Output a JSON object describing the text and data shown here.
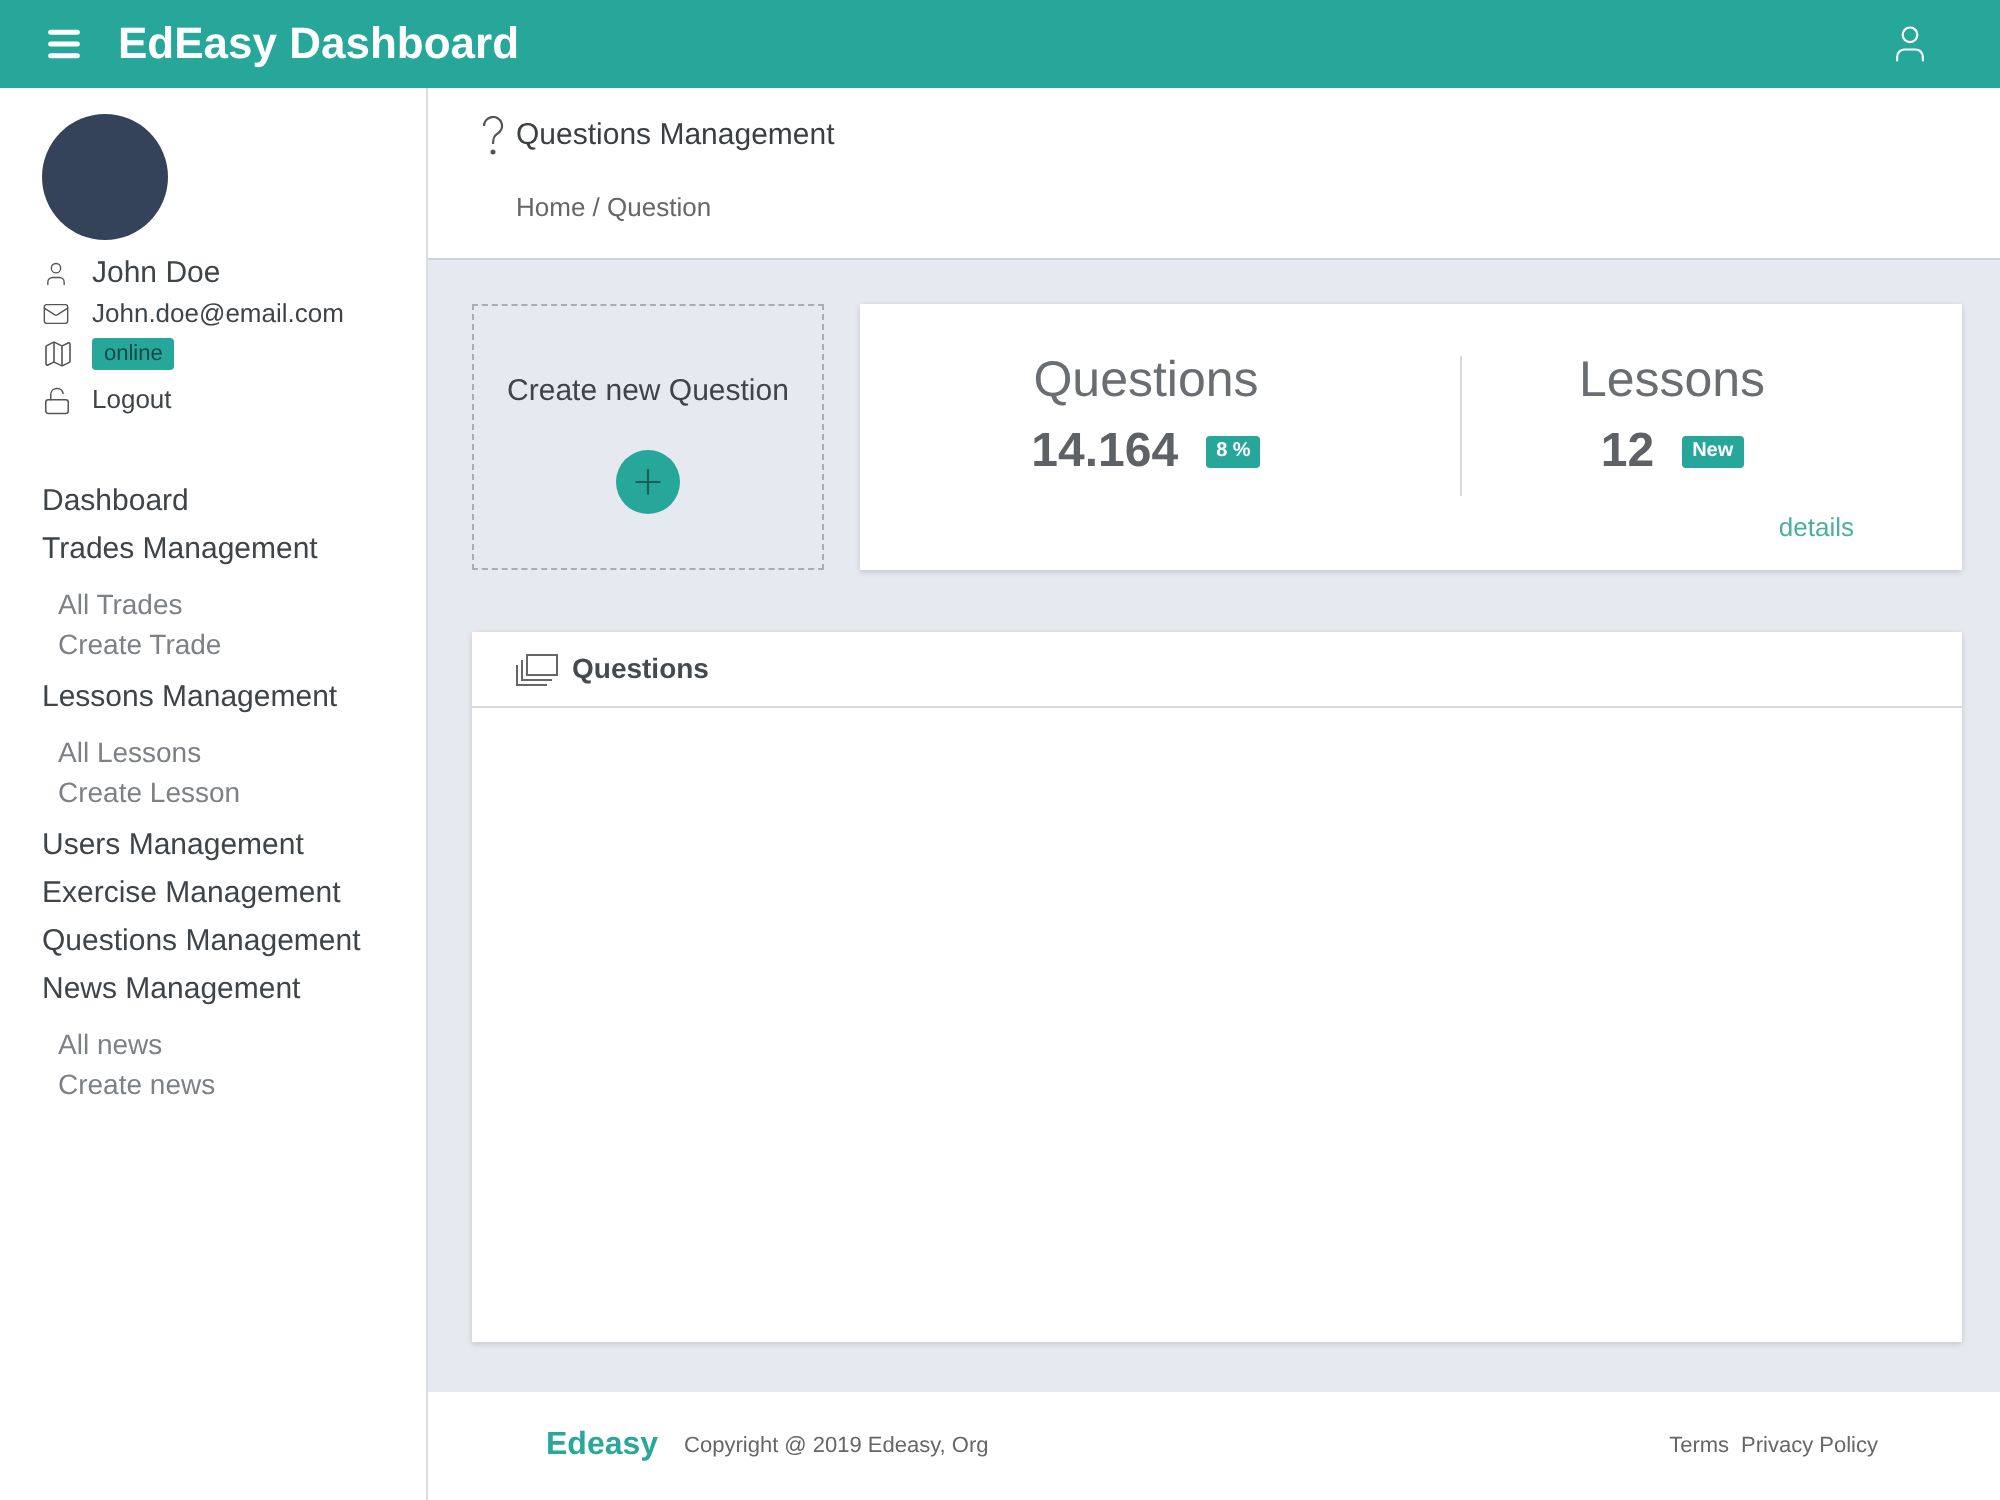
{
  "header": {
    "title": "EdEasy Dashboard"
  },
  "profile": {
    "name": "John Doe",
    "email": "John.doe@email.com",
    "status": "online",
    "logout": "Logout"
  },
  "sidebar": {
    "items": [
      {
        "label": "Dashboard"
      },
      {
        "label": "Trades Management",
        "children": [
          {
            "label": "All Trades"
          },
          {
            "label": "Create Trade"
          }
        ]
      },
      {
        "label": "Lessons Management",
        "children": [
          {
            "label": "All Lessons"
          },
          {
            "label": "Create Lesson"
          }
        ]
      },
      {
        "label": "Users Management"
      },
      {
        "label": "Exercise Management"
      },
      {
        "label": "Questions Management"
      },
      {
        "label": "News Management",
        "children": [
          {
            "label": "All news"
          },
          {
            "label": "Create news"
          }
        ]
      }
    ]
  },
  "page_header": {
    "title": "Questions Management",
    "breadcrumb": "Home / Question"
  },
  "create_card": {
    "label": "Create new Question"
  },
  "stats": {
    "items": [
      {
        "label": "Questions",
        "value": "14.164",
        "badge": "8 %"
      },
      {
        "label": "Lessons",
        "value": "12",
        "badge": "New"
      }
    ],
    "link": "details"
  },
  "panel": {
    "title": "Questions"
  },
  "footer": {
    "brand": "Edeasy",
    "copyright": "Copyright @ 2019 Edeasy, Org",
    "links": [
      "Terms",
      "Privacy Policy"
    ]
  }
}
